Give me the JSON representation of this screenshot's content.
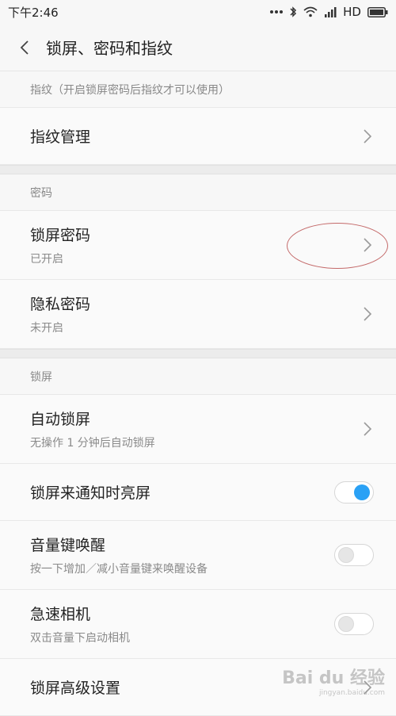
{
  "status_bar": {
    "time": "下午2:46",
    "network": "HD"
  },
  "header": {
    "title": "锁屏、密码和指纹"
  },
  "sections": {
    "fingerprint": {
      "header": "指纹（开启锁屏密码后指纹才可以使用）",
      "items": [
        {
          "title": "指纹管理"
        }
      ]
    },
    "password": {
      "header": "密码",
      "items": [
        {
          "title": "锁屏密码",
          "subtitle": "已开启"
        },
        {
          "title": "隐私密码",
          "subtitle": "未开启"
        }
      ]
    },
    "lockscreen": {
      "header": "锁屏",
      "items": [
        {
          "title": "自动锁屏",
          "subtitle": "无操作 1 分钟后自动锁屏"
        },
        {
          "title": "锁屏来通知时亮屏",
          "toggle": "on"
        },
        {
          "title": "音量键唤醒",
          "subtitle": "按一下增加／减小音量键来唤醒设备",
          "toggle": "off"
        },
        {
          "title": "急速相机",
          "subtitle": "双击音量下启动相机",
          "toggle": "off"
        },
        {
          "title": "锁屏高级设置"
        }
      ]
    }
  },
  "watermark": {
    "brand": "Bai du 经验",
    "url": "jingyan.baidu.com"
  },
  "colors": {
    "accent": "#2aa1f5",
    "annotation": "#c46a6a"
  }
}
